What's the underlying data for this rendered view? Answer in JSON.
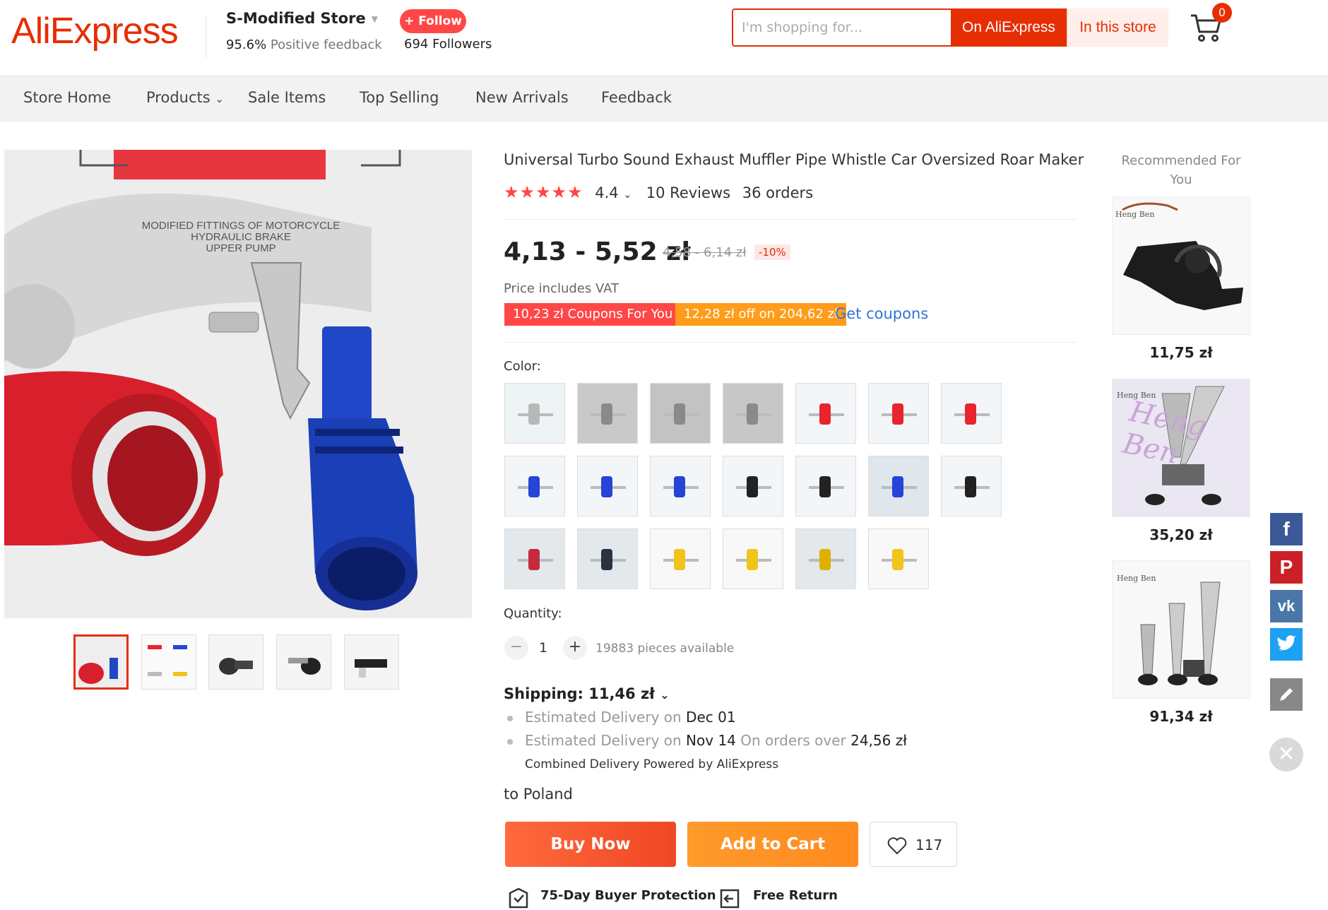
{
  "header": {
    "logo": "AliExpress",
    "store_name": "S-Modified Store",
    "feedback_pct": "95.6%",
    "feedback_label": "Positive feedback",
    "follow_label": "+ Follow",
    "followers_count": "694",
    "followers_label": "Followers",
    "search_placeholder": "I'm shopping for...",
    "search_ali": "On AliExpress",
    "search_store": "In this store",
    "cart_count": "0"
  },
  "nav": {
    "items": [
      "Store Home",
      "Products",
      "Sale Items",
      "Top Selling",
      "New Arrivals",
      "Feedback"
    ]
  },
  "product": {
    "image_caption": [
      "MODIFIED FITTINGS OF MOTORCYCLE",
      "HYDRAULIC BRAKE",
      "UPPER PUMP"
    ],
    "title": "Universal Turbo Sound Exhaust Muffler Pipe Whistle Car Oversized Roar Maker",
    "rating": "4.4",
    "reviews": "10 Reviews",
    "orders": "36 orders",
    "price": "4,13 - 5,52 zł",
    "old_price": "4,58 - 6,14 zł",
    "discount": "-10%",
    "vat_note": "Price includes VAT",
    "coupon1": "10,23 zł Coupons For You",
    "coupon2": "12,28 zł off on 204,62 zł",
    "get_coupons": "Get coupons",
    "color_label": "Color:",
    "quantity_label": "Quantity:",
    "quantity": "1",
    "available": "19883 pieces available",
    "shipping": "Shipping: 11,46 zł",
    "est1_label": "Estimated Delivery on",
    "est1_date": "Dec 01",
    "est2_label": "Estimated Delivery on",
    "est2_date": "Nov 14",
    "est2_note": "On orders over",
    "est2_amount": "24,56 zł",
    "combined": "Combined Delivery Powered by AliExpress",
    "to_label": "to",
    "to_country": "Poland",
    "buy_now": "Buy Now",
    "add_to_cart": "Add to Cart",
    "wishlist_count": "117",
    "protection1": "75-Day Buyer Protection",
    "protection2": "Free Return"
  },
  "swatches": [
    {
      "bg": "#eef3f6",
      "color": "#b8b8b8"
    },
    {
      "bg": "#c9c9c9",
      "color": "#8a8a8a"
    },
    {
      "bg": "#c3c3c3",
      "color": "#8a8a8a"
    },
    {
      "bg": "#c7c7c7",
      "color": "#8a8a8a"
    },
    {
      "bg": "#f3f6f8",
      "color": "#e8252e"
    },
    {
      "bg": "#f3f6f8",
      "color": "#e8252e"
    },
    {
      "bg": "#f3f6f8",
      "color": "#e8252e"
    },
    {
      "bg": "#f3f6f8",
      "color": "#2544d8"
    },
    {
      "bg": "#f3f6f8",
      "color": "#2544d8"
    },
    {
      "bg": "#f3f6f8",
      "color": "#2544d8"
    },
    {
      "bg": "#f3f6f8",
      "color": "#222222"
    },
    {
      "bg": "#f3f6f8",
      "color": "#222222"
    },
    {
      "bg": "#dfe6ec",
      "color": "#2544d8"
    },
    {
      "bg": "#f3f6f8",
      "color": "#222222"
    },
    {
      "bg": "#e3e8ec",
      "color": "#c42a3e"
    },
    {
      "bg": "#e3e8ec",
      "color": "#2a3340"
    },
    {
      "bg": "#f8f8f8",
      "color": "#f0c419"
    },
    {
      "bg": "#f8f8f8",
      "color": "#f0c419"
    },
    {
      "bg": "#e3e8ec",
      "color": "#e0b000"
    },
    {
      "bg": "#f8f8f8",
      "color": "#f0c419"
    }
  ],
  "recommended": {
    "title": "Recommended For You",
    "items": [
      {
        "price": "11,75 zł",
        "brand": "Heng Ben"
      },
      {
        "price": "35,20 zł",
        "brand": "Heng Ben"
      },
      {
        "price": "91,34 zł",
        "brand": "Heng Ben"
      }
    ]
  },
  "share": {
    "facebook": "f",
    "pinterest": "P",
    "vk": "vk"
  }
}
